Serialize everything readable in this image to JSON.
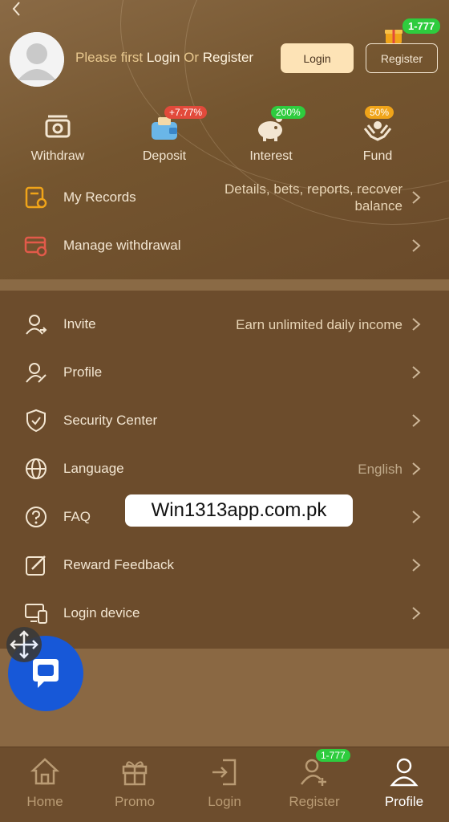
{
  "header": {
    "prompt_prefix": "Please first ",
    "prompt_login": "Login",
    "prompt_or": " Or ",
    "prompt_register": "Register",
    "login_button": "Login",
    "register_button": "Register",
    "gift_badge": "1-777"
  },
  "quick_actions": [
    {
      "label": "Withdraw",
      "badge": "",
      "icon": "wallet-icon"
    },
    {
      "label": "Deposit",
      "badge": "+7.77%",
      "badge_color": "#e24a3b",
      "icon": "deposit-icon"
    },
    {
      "label": "Interest",
      "badge": "200%",
      "badge_color": "#2ecc3e",
      "icon": "piggy-bank-icon"
    },
    {
      "label": "Fund",
      "badge": "50%",
      "badge_color": "#f0a419",
      "icon": "fund-hands-icon"
    }
  ],
  "records": [
    {
      "label": "My Records",
      "hint_line1": "Details, bets, reports, recover",
      "hint_line2": "balance",
      "icon": "records-icon"
    },
    {
      "label": "Manage withdrawal",
      "hint_line1": "",
      "hint_line2": "",
      "icon": "card-settings-icon"
    }
  ],
  "menu": [
    {
      "label": "Invite",
      "hint": "Earn unlimited daily income",
      "icon": "invite-user-icon"
    },
    {
      "label": "Profile",
      "hint": "",
      "icon": "profile-edit-icon"
    },
    {
      "label": "Security Center",
      "hint": "",
      "icon": "shield-check-icon"
    },
    {
      "label": "Language",
      "hint": "English",
      "icon": "globe-icon"
    },
    {
      "label": "FAQ",
      "hint": "",
      "icon": "question-icon"
    },
    {
      "label": "Reward Feedback",
      "hint": "",
      "icon": "feedback-edit-icon"
    },
    {
      "label": "Login device",
      "hint": "",
      "icon": "devices-icon"
    }
  ],
  "watermark": "Win1313app.com.pk",
  "bottom_nav": [
    {
      "label": "Home",
      "icon": "home-icon",
      "active": false
    },
    {
      "label": "Promo",
      "icon": "gift-icon",
      "active": false
    },
    {
      "label": "Login",
      "icon": "login-door-icon",
      "active": false
    },
    {
      "label": "Register",
      "icon": "add-user-icon",
      "active": false,
      "badge": "1-777"
    },
    {
      "label": "Profile",
      "icon": "user-icon",
      "active": true
    }
  ],
  "colors": {
    "accent_gold": "#e8c88e",
    "login_button_bg": "#fde3b6",
    "badge_green": "#2ecc3e",
    "badge_red": "#e24a3b",
    "badge_orange": "#f0a419",
    "chat_blue": "#1758d8"
  }
}
